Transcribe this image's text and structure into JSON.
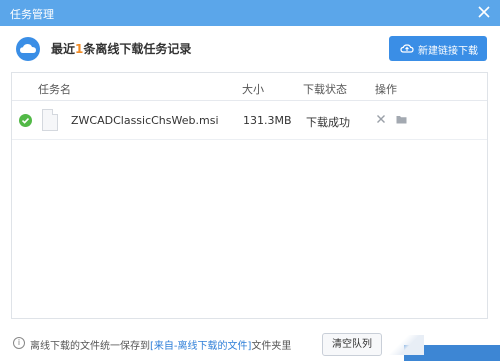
{
  "window": {
    "title": "任务管理"
  },
  "summary": {
    "prefix": "最近",
    "count": "1",
    "suffix": "条离线下载任务记录"
  },
  "toolbar": {
    "new_link_label": "新建链接下载"
  },
  "table": {
    "columns": {
      "name": "任务名",
      "size": "大小",
      "status": "下载状态",
      "actions": "操作"
    },
    "rows": [
      {
        "name": "ZWCADClassicChsWeb.msi",
        "size": "131.3MB",
        "status": "下载成功"
      }
    ]
  },
  "footer": {
    "note_prefix": "离线下载的文件统一保存到",
    "note_link": "[来自-离线下载的文件]",
    "note_suffix": "文件夹里",
    "clear_label": "清空队列"
  },
  "colors": {
    "titlebar": "#5ba6ea",
    "accent": "#3a8ee6",
    "success": "#52b947",
    "count": "#f08a24"
  }
}
